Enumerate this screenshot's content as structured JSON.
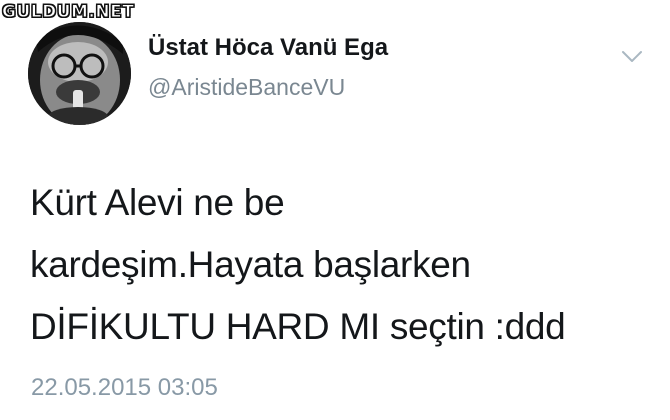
{
  "watermark": {
    "text": "GULDUM.NET"
  },
  "tweet": {
    "author": {
      "display_name": "Üstat Höca Vanü Ega",
      "handle": "@AristideBanceVU",
      "avatar_icon": "profile-photo"
    },
    "menu_icon": "chevron-down-icon",
    "text_lines": [
      "Kürt Alevi ne be",
      "kardeşim.Hayata başlarken",
      "DİFİKULTU HARD MI seçtin :ddd"
    ],
    "timestamp": "22.05.2015 03:05"
  },
  "colors": {
    "name": "#14171a",
    "handle": "#7a8791",
    "timestamp": "#8899a6",
    "chevron": "#aab8c2"
  }
}
